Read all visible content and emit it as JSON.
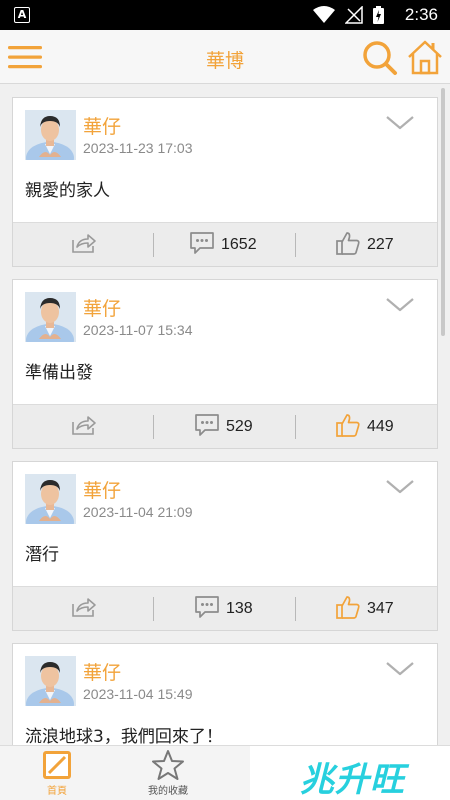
{
  "status_bar": {
    "time": "2:36",
    "app_indicator": "A"
  },
  "header": {
    "title": "華博",
    "menu_icon": "hamburger-menu-icon",
    "search_icon": "search-icon",
    "home_icon": "home-icon"
  },
  "posts": [
    {
      "author": "華仔",
      "date": "2023-11-23 17:03",
      "text": "親愛的家人",
      "comments": "1652",
      "likes": "227",
      "liked": false
    },
    {
      "author": "華仔",
      "date": "2023-11-07 15:34",
      "text": "準備出發",
      "comments": "529",
      "likes": "449",
      "liked": true
    },
    {
      "author": "華仔",
      "date": "2023-11-04 21:09",
      "text": "潛行",
      "comments": "138",
      "likes": "347",
      "liked": true
    },
    {
      "author": "華仔",
      "date": "2023-11-04 15:49",
      "text": "流浪地球3，我們回來了！",
      "comments": "",
      "likes": "",
      "liked": false
    }
  ],
  "bottom_nav": {
    "items": [
      {
        "label": "首頁",
        "icon": "edit-icon",
        "active": true
      },
      {
        "label": "我的收藏",
        "icon": "star-icon",
        "active": false
      }
    ],
    "brand_text": "兆升旺"
  },
  "colors": {
    "accent": "#f2a33a",
    "brand": "#27d0de",
    "liked": "#f2a33a",
    "neutral_icon": "#8c8c8c"
  }
}
